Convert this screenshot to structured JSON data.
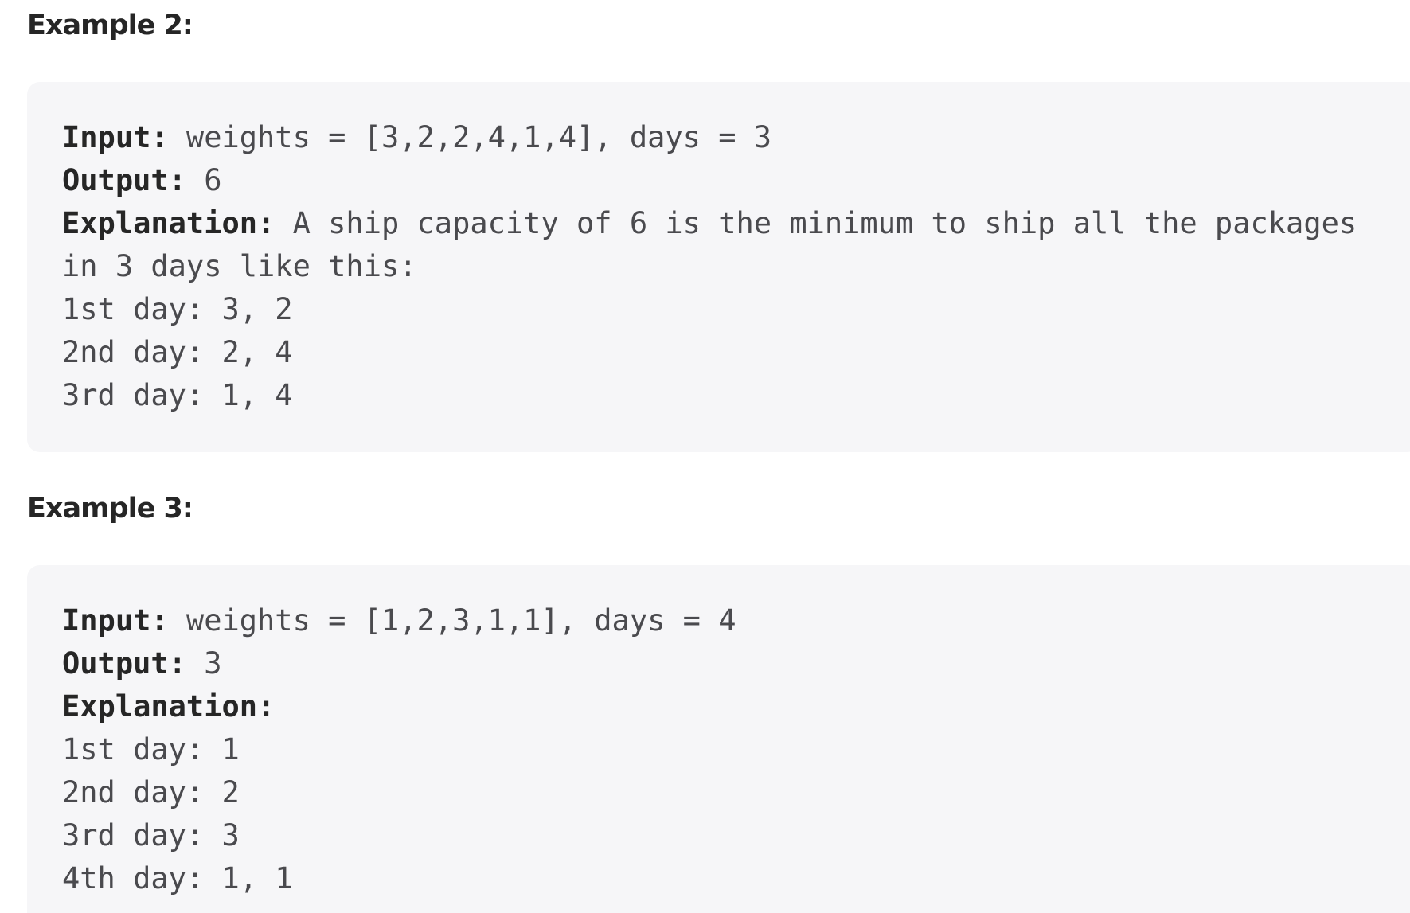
{
  "example2": {
    "heading": "Example 2:",
    "input_label": "Input:",
    "input_value": " weights = [3,2,2,4,1,4], days = 3",
    "output_label": "Output:",
    "output_value": " 6",
    "explanation_label": "Explanation:",
    "explanation_text": " A ship capacity of 6 is the minimum to ship all the packages",
    "explanation_continued": "in 3 days like this:",
    "days": [
      "1st day: 3, 2",
      "2nd day: 2, 4",
      "3rd day: 1, 4"
    ]
  },
  "example3": {
    "heading": "Example 3:",
    "input_label": "Input:",
    "input_value": " weights = [1,2,3,1,1], days = 4",
    "output_label": "Output:",
    "output_value": " 3",
    "explanation_label": "Explanation:",
    "days": [
      "1st day: 1",
      "2nd day: 2",
      "3rd day: 3",
      "4th day: 1, 1"
    ]
  }
}
